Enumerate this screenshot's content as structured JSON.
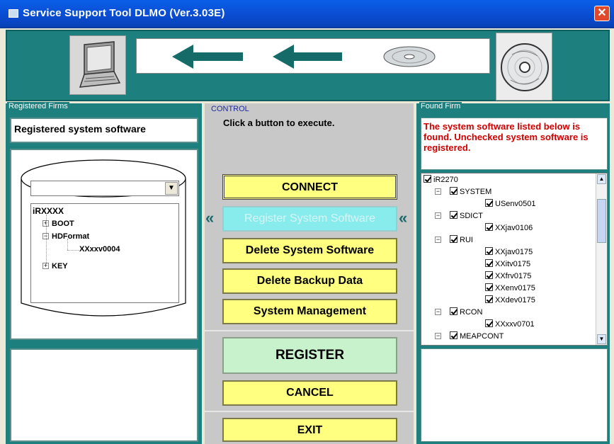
{
  "window": {
    "title": "Service Support Tool DLMO (Ver.3.03E)",
    "close_glyph": "✕"
  },
  "banner": {
    "icons": [
      "laptop-icon",
      "left-arrow-icon",
      "left-arrow-icon",
      "disc-icon",
      "cd-icon"
    ]
  },
  "left": {
    "group_label": "Registered Firms",
    "header_text": "Registered system software",
    "combo_value": "",
    "tree": [
      {
        "label": "iRXXXX",
        "level": 0,
        "bold": true,
        "toggle": ""
      },
      {
        "label": "BOOT",
        "level": 1,
        "bold": true,
        "toggle": "+"
      },
      {
        "label": "HDFormat",
        "level": 1,
        "bold": true,
        "toggle": "−"
      },
      {
        "label": "XXxxv0004",
        "level": 2,
        "bold": true,
        "toggle": ""
      },
      {
        "label": "KEY",
        "level": 1,
        "bold": true,
        "toggle": "+"
      }
    ]
  },
  "control": {
    "group_label": "CONTROL",
    "instruction": "Click a button to execute.",
    "chevron": "«",
    "buttons": {
      "connect": "CONNECT",
      "register_sw": "Register System Software",
      "delete_sw": "Delete System Software",
      "delete_backup": "Delete Backup Data",
      "system_mgmt": "System Management",
      "register": "REGISTER",
      "cancel": "CANCEL",
      "exit": "EXIT"
    }
  },
  "right": {
    "group_label": "Found Firm",
    "message": "The system software listed below is found. Unchecked system software is registered.",
    "tree": [
      {
        "label": "iR2270",
        "level": 0,
        "toggle": ""
      },
      {
        "label": "SYSTEM",
        "level": 1,
        "toggle": "−"
      },
      {
        "label": "USenv0501",
        "level": 2,
        "toggle": ""
      },
      {
        "label": "SDICT",
        "level": 1,
        "toggle": "−"
      },
      {
        "label": "XXjav0106",
        "level": 2,
        "toggle": ""
      },
      {
        "label": "RUI",
        "level": 1,
        "toggle": "−"
      },
      {
        "label": "XXjav0175",
        "level": 2,
        "toggle": ""
      },
      {
        "label": "XXitv0175",
        "level": 2,
        "toggle": ""
      },
      {
        "label": "XXfrv0175",
        "level": 2,
        "toggle": ""
      },
      {
        "label": "XXenv0175",
        "level": 2,
        "toggle": ""
      },
      {
        "label": "XXdev0175",
        "level": 2,
        "toggle": ""
      },
      {
        "label": "RCON",
        "level": 1,
        "toggle": "−"
      },
      {
        "label": "XXxxv0701",
        "level": 2,
        "toggle": ""
      },
      {
        "label": "MEAPCONT",
        "level": 1,
        "toggle": "−"
      }
    ]
  },
  "colors": {
    "teal": "#1d7f7e",
    "button_yellow": "#ffff80",
    "button_cyan": "#88ecec",
    "button_green": "#c8f2cc",
    "alert_red": "#d00000"
  }
}
